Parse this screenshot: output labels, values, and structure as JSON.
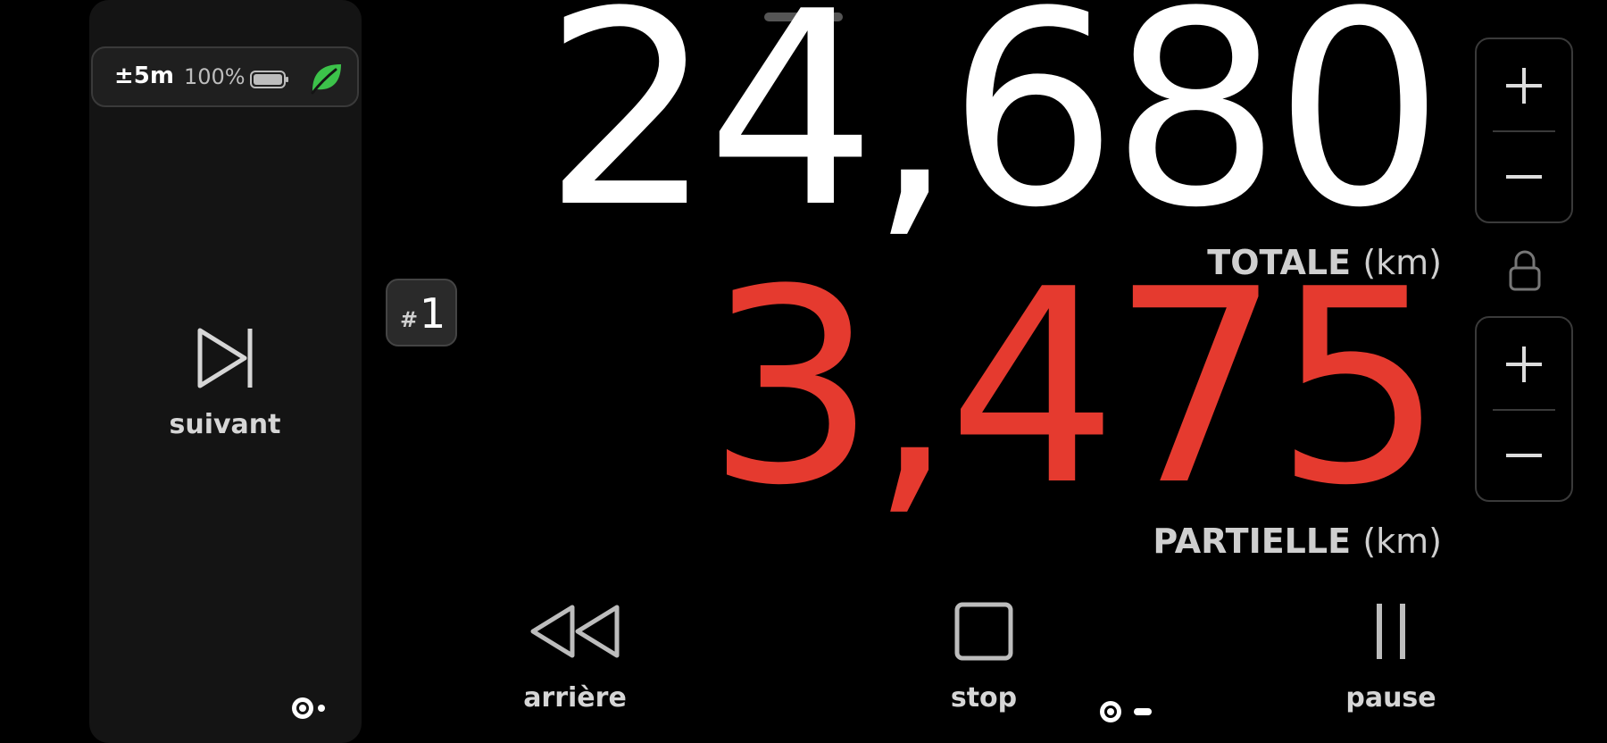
{
  "status": {
    "accuracy": "±5m",
    "battery": "100%",
    "icons": [
      "battery-icon",
      "leaf-icon"
    ],
    "leaf_color": "#3cc24a"
  },
  "side_panel": {
    "next_label": "suivant"
  },
  "trip": {
    "hash": "#",
    "number": "1"
  },
  "total": {
    "value": "24,680",
    "label": "TOTALE",
    "unit": "(km)"
  },
  "partial": {
    "value": "3,475",
    "label": "PARTIELLE",
    "unit": "(km)",
    "color": "#e53a2f"
  },
  "controls": {
    "back_label": "arrière",
    "stop_label": "stop",
    "pause_label": "pause"
  }
}
